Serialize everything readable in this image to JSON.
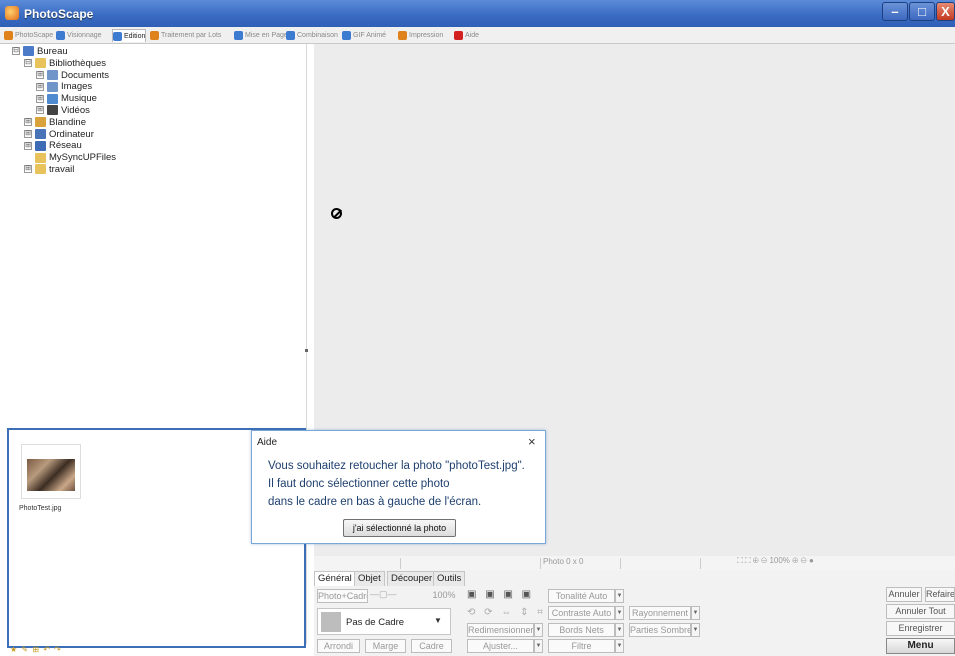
{
  "window": {
    "title": "PhotoScape",
    "minimize": "–",
    "maximize": "□",
    "close": "X"
  },
  "tabs": [
    {
      "label": "PhotoScape",
      "color": "#e0821c"
    },
    {
      "label": "Visionnage",
      "color": "#3d7bd0"
    },
    {
      "label": "Edition",
      "color": "#3d7bd0"
    },
    {
      "label": "Traitement par Lots",
      "color": "#e0821c"
    },
    {
      "label": "Mise en Page",
      "color": "#3d7bd0"
    },
    {
      "label": "Combinaison",
      "color": "#3d7bd0"
    },
    {
      "label": "GIF Animé",
      "color": "#3d7bd0"
    },
    {
      "label": "Impression",
      "color": "#e0821c"
    },
    {
      "label": "Aide",
      "color": "#d32020"
    }
  ],
  "active_tab": "Edition",
  "tree": [
    {
      "label": "Bureau",
      "expander": "⊟",
      "icon_color": "#4a7ac8"
    },
    {
      "label": "Bibliothèques",
      "expander": "⊟",
      "icon_color": "#e8c25a"
    },
    {
      "label": "Documents",
      "expander": "⊞",
      "icon_color": "#6f95c9"
    },
    {
      "label": "Images",
      "expander": "⊞",
      "icon_color": "#6f95c9"
    },
    {
      "label": "Musique",
      "expander": "⊞",
      "icon_color": "#4f8ad0"
    },
    {
      "label": "Vidéos",
      "expander": "⊞",
      "icon_color": "#444"
    },
    {
      "label": "Blandine",
      "expander": "⊞",
      "icon_color": "#d9a23a"
    },
    {
      "label": "Ordinateur",
      "expander": "⊞",
      "icon_color": "#4a74b8"
    },
    {
      "label": "Réseau",
      "expander": "⊞",
      "icon_color": "#3f6db5"
    },
    {
      "label": "MySyncUPFiles",
      "expander": "",
      "icon_color": "#e8c25a"
    },
    {
      "label": "travail",
      "expander": "⊞",
      "icon_color": "#e8c25a"
    }
  ],
  "thumbnail": {
    "filename": "PhotoTest.jpg"
  },
  "aide_dialog": {
    "title": "Aide",
    "close": "×",
    "lines": [
      "Vous souhaitez retoucher la photo \"photoTest.jpg\".",
      "Il faut donc sélectionner cette photo",
      "dans le cadre en bas à gauche de l'écran."
    ],
    "button": "j'ai sélectionné la photo"
  },
  "status": {
    "photo": "Photo 0 x 0",
    "zoom_tools": "⛶ ⛶ ⊕ ⊖ 100% ⊕ ⊖ ●"
  },
  "bottom_tabs": [
    "Général",
    "Objet",
    "Découper",
    "Outils"
  ],
  "controls": {
    "photo_cadre": "Photo+Cadre",
    "slider": "—▢—",
    "percent": "100%",
    "frame_label": "Pas de Cadre",
    "arrondi": "Arrondi",
    "marge": "Marge",
    "cadre": "Cadre",
    "redimensionner": "Redimensionner",
    "ajuster": "Ajuster...",
    "tonalite": "Tonalité Auto",
    "contraste": "Contraste Auto",
    "bords_nets": "Bords Nets",
    "filtre": "Filtre",
    "rayonnement": "Rayonnement",
    "parties_sombres": "Parties Sombres",
    "icons_row1": "▣ ▣ ▣ ▣",
    "icons_row2": "⟲ ⟳ ⇔ ⇕ ⌗",
    "dropdown_arrow": "▼"
  },
  "right_buttons": {
    "annuler": "Annuler",
    "refaire": "Refaire",
    "annuler_tout": "Annuler Tout",
    "enregistrer": "Enregistrer",
    "menu": "Menu"
  },
  "bottom_left_icons": "★ ✎ ⊞ ↶ ↷"
}
